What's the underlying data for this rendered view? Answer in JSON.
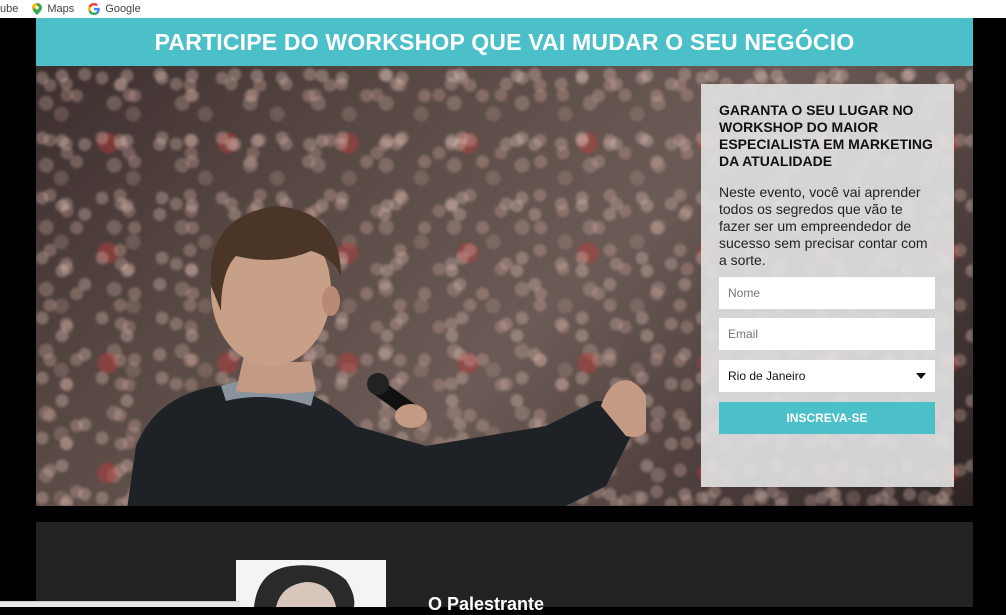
{
  "bookmarks": {
    "items": [
      {
        "label": "ube",
        "icon": "youtube-icon"
      },
      {
        "label": "Maps",
        "icon": "maps-pin-icon"
      },
      {
        "label": "Google",
        "icon": "google-icon"
      }
    ]
  },
  "header": {
    "title": "PARTICIPE DO WORKSHOP QUE VAI MUDAR O SEU NEGÓCIO"
  },
  "form": {
    "heading": "GARANTA O SEU LUGAR NO WORKSHOP DO MAIOR ESPECIALISTA EM MARKETING DA ATUALIDADE",
    "description": "Neste evento, você vai aprender todos os segredos que vão te fazer ser um empreendedor de sucesso sem precisar contar com a sorte.",
    "name_placeholder": "Nome",
    "email_placeholder": "Email",
    "city_selected": "Rio de Janeiro",
    "submit_label": "INSCREVA-SE"
  },
  "speaker_section": {
    "title": "O Palestrante"
  },
  "colors": {
    "accent": "#4bc0c8",
    "background": "#000000",
    "section_bg": "#222222"
  }
}
